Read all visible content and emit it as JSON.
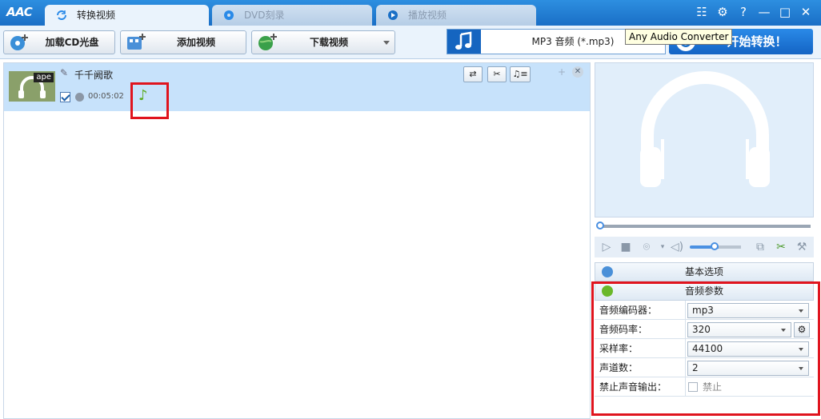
{
  "app": {
    "logo": "AAC"
  },
  "tabs": [
    {
      "label": "转换视频",
      "active": true
    },
    {
      "label": "DVD刻录",
      "active": false
    },
    {
      "label": "播放视频",
      "active": false
    }
  ],
  "window": {
    "help": "?",
    "minimize": "—",
    "maximize": "□",
    "close": "✕"
  },
  "toolbar": {
    "load_cd": "加载CD光盘",
    "add_video": "添加视频",
    "download_video": "下载视频",
    "output_format": "MP3 音频 (*.mp3)",
    "start": "开始转换！",
    "tooltip": "Any Audio Converter"
  },
  "file": {
    "name": "千千阙歌",
    "format_badge": "ape",
    "duration": "00:05:02",
    "checked": true
  },
  "sections": {
    "basic": "基本选项",
    "audio": "音频参数"
  },
  "params": [
    {
      "label": "音频编码器：",
      "value": "mp3"
    },
    {
      "label": "音频码率：",
      "value": "320"
    },
    {
      "label": "采样率：",
      "value": "44100"
    },
    {
      "label": "声道数：",
      "value": "2"
    },
    {
      "label": "禁止声音输出：",
      "value": "禁止"
    }
  ],
  "colors": {
    "accent": "#1565c0",
    "highlight": "#e0141e",
    "row_selected": "#c7e2fb"
  }
}
